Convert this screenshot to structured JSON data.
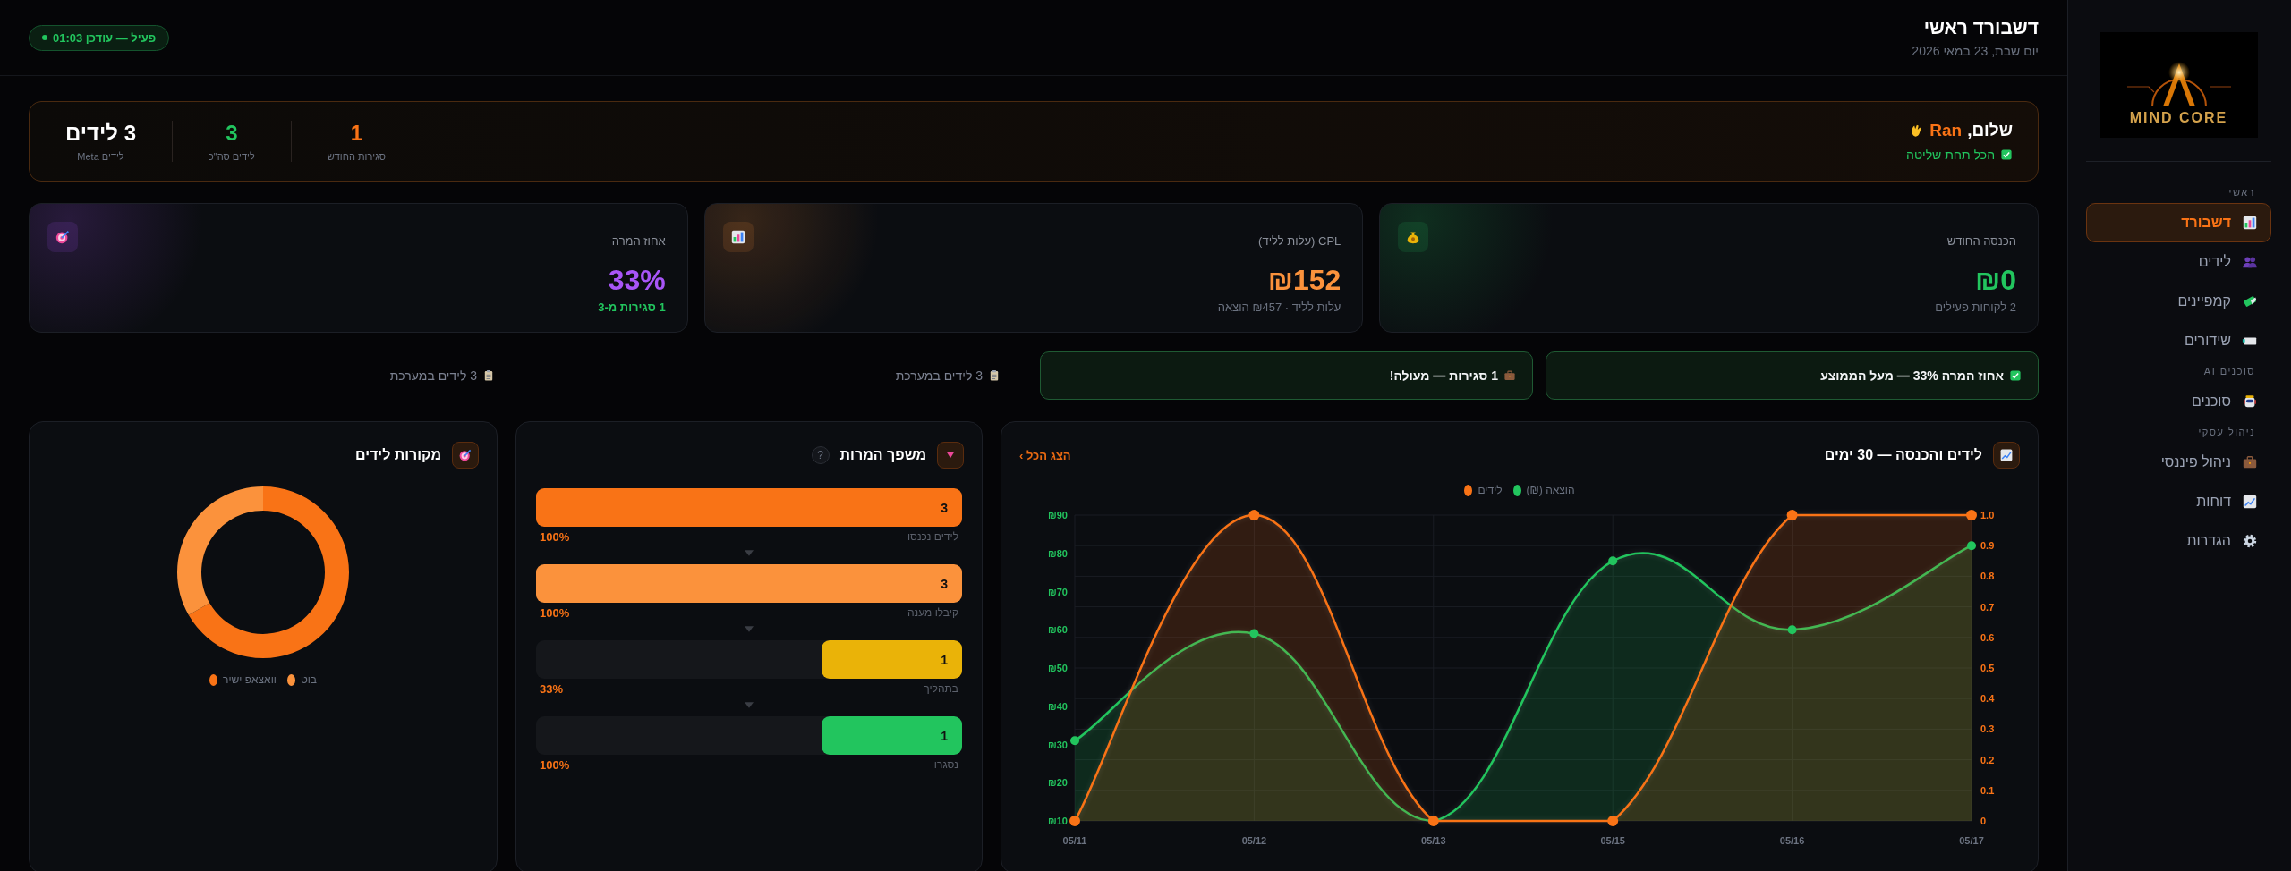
{
  "sidebar": {
    "logo": {
      "text": "MIND CORE"
    },
    "sections": [
      {
        "title": "ראשי",
        "items": [
          {
            "label": "דשבורד",
            "selected": true
          },
          {
            "label": "לידים",
            "selected": false
          },
          {
            "label": "קמפיינים",
            "selected": false
          },
          {
            "label": "שידורים",
            "selected": false
          }
        ]
      },
      {
        "title": "סוכנים AI",
        "items": [
          {
            "label": "סוכנים",
            "selected": false
          }
        ]
      },
      {
        "title": "ניהול עסקי",
        "items": [
          {
            "label": "ניהול פיננסי",
            "selected": false
          },
          {
            "label": "דוחות",
            "selected": false
          },
          {
            "label": "הגדרות",
            "selected": false
          }
        ]
      }
    ]
  },
  "header": {
    "title": "דשבורד ראשי",
    "date": "יום שבת, 23 במאי 2026",
    "status": "פעיל — עודכן 01:03"
  },
  "welcome": {
    "greeting": "שלום,",
    "name": "Ran",
    "message": "הכל תחת שליטה",
    "stats": [
      {
        "value": "1",
        "label": "סגירות החודש",
        "color": "#f97316"
      },
      {
        "value": "3",
        "label": "לידים סה\"כ",
        "color": "#22c55e"
      },
      {
        "value": "3 לידים",
        "label": "לידים Meta",
        "color": "#ffffff"
      }
    ]
  },
  "kpis": [
    {
      "label": "הכנסה החודש",
      "value": "₪0",
      "note": "2 לקוחות פעילים",
      "note_highlight": false,
      "color": "#22c55e"
    },
    {
      "label": "CPL (עלות לליד)",
      "value": "₪152",
      "note": "עלות לליד · ₪457 הוצאה",
      "note_highlight": false,
      "color": "#fb923c"
    },
    {
      "label": "אחוז המרה",
      "value": "33%",
      "note": "1 סגירות מ-3",
      "note_highlight": true,
      "color": "#a855f7"
    }
  ],
  "alerts": [
    {
      "kind": "success",
      "text": "אחוז המרה 33% — מעל הממוצע"
    },
    {
      "kind": "success",
      "text": "1 סגירות — מעולה!"
    },
    {
      "kind": "plain",
      "text": "3 לידים במערכת"
    },
    {
      "kind": "plain",
      "text": "3 לידים במערכת"
    }
  ],
  "trend": {
    "title": "לידים והכנסה — 30 ימים",
    "link": "הצג הכל ›",
    "chart_data": {
      "type": "area",
      "grid": true,
      "categories": [
        "05/11",
        "05/12",
        "05/13",
        "05/15",
        "05/16",
        "05/17"
      ],
      "series": [
        {
          "name": "הוצאה (₪)",
          "color": "#22c55e",
          "axis": "y",
          "marker": true,
          "values": [
            31,
            59,
            10,
            78,
            60,
            82
          ]
        },
        {
          "name": "לידים",
          "color": "#f97316",
          "axis": "y2",
          "marker": true,
          "values": [
            0,
            1,
            0,
            0,
            1,
            1
          ]
        }
      ],
      "legend": "top",
      "ylim": [
        10,
        90
      ],
      "yticks": [
        {
          "value": 10,
          "label": "₪10"
        },
        {
          "value": 20,
          "label": "₪20"
        },
        {
          "value": 30,
          "label": "₪30"
        },
        {
          "value": 40,
          "label": "₪40"
        },
        {
          "value": 50,
          "label": "₪50"
        },
        {
          "value": 60,
          "label": "₪60"
        },
        {
          "value": 70,
          "label": "₪70"
        },
        {
          "value": 80,
          "label": "₪80"
        },
        {
          "value": 90,
          "label": "₪90"
        }
      ],
      "y2lim": [
        0,
        1
      ],
      "y2ticks": [
        {
          "value": 0,
          "label": "0"
        },
        {
          "value": 0.1,
          "label": "0.1"
        },
        {
          "value": 0.2,
          "label": "0.2"
        },
        {
          "value": 0.3,
          "label": "0.3"
        },
        {
          "value": 0.4,
          "label": "0.4"
        },
        {
          "value": 0.5,
          "label": "0.5"
        },
        {
          "value": 0.6,
          "label": "0.6"
        },
        {
          "value": 0.7,
          "label": "0.7"
        },
        {
          "value": 0.8,
          "label": "0.8"
        },
        {
          "value": 0.9,
          "label": "0.9"
        },
        {
          "value": 1,
          "label": "1.0"
        }
      ]
    }
  },
  "funnel": {
    "title": "משפך המרות",
    "help": "?",
    "stages": [
      {
        "label": "לידים נכנסו",
        "count": "3",
        "percent": "100%",
        "level": 1,
        "color": "#f97316"
      },
      {
        "label": "קיבלו מענה",
        "count": "3",
        "percent": "100%",
        "level": 1,
        "color": "#fb923c"
      },
      {
        "label": "בתהליך",
        "count": "1",
        "percent": "33%",
        "level": 0.33,
        "color": "#eab308"
      },
      {
        "label": "נסגרו",
        "count": "1",
        "percent": "100%",
        "level": 0.33,
        "color": "#22c55e"
      }
    ]
  },
  "sources": {
    "title": "מקורות לידים",
    "chart_data": {
      "type": "donut",
      "categories": [
        "וואצאפ ישיר",
        "בוט"
      ],
      "values": [
        66.7,
        33.3
      ],
      "colors": [
        "#f97316",
        "#fb923c"
      ],
      "legend": "bottom"
    }
  }
}
